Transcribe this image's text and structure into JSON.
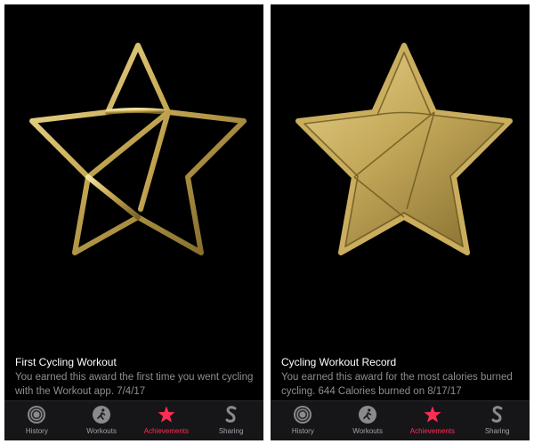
{
  "colors": {
    "background": "#000000",
    "gold_light": "#e6d38a",
    "gold_dark": "#6e5a22",
    "active_tab": "#ff2d55",
    "inactive_tab": "#a3a3a8",
    "description_text": "#8e8e93"
  },
  "panels": [
    {
      "badge_icon": "cycling-star-outline-badge",
      "badge_style": "outline",
      "title": "First Cycling Workout",
      "description": "You earned this award the first time you went cycling with the Workout app. 7/4/17",
      "active_tab": "Achievements"
    },
    {
      "badge_icon": "cycling-star-filled-badge",
      "badge_style": "filled",
      "title": "Cycling Workout Record",
      "description": "You earned this award for the most calories burned cycling. 644 Calories burned on 8/17/17",
      "active_tab": "Achievements"
    }
  ],
  "tabs": [
    {
      "label": "History",
      "icon": "history-rings-icon"
    },
    {
      "label": "Workouts",
      "icon": "workouts-runner-icon"
    },
    {
      "label": "Achievements",
      "icon": "achievements-star-icon"
    },
    {
      "label": "Sharing",
      "icon": "sharing-icon"
    }
  ]
}
